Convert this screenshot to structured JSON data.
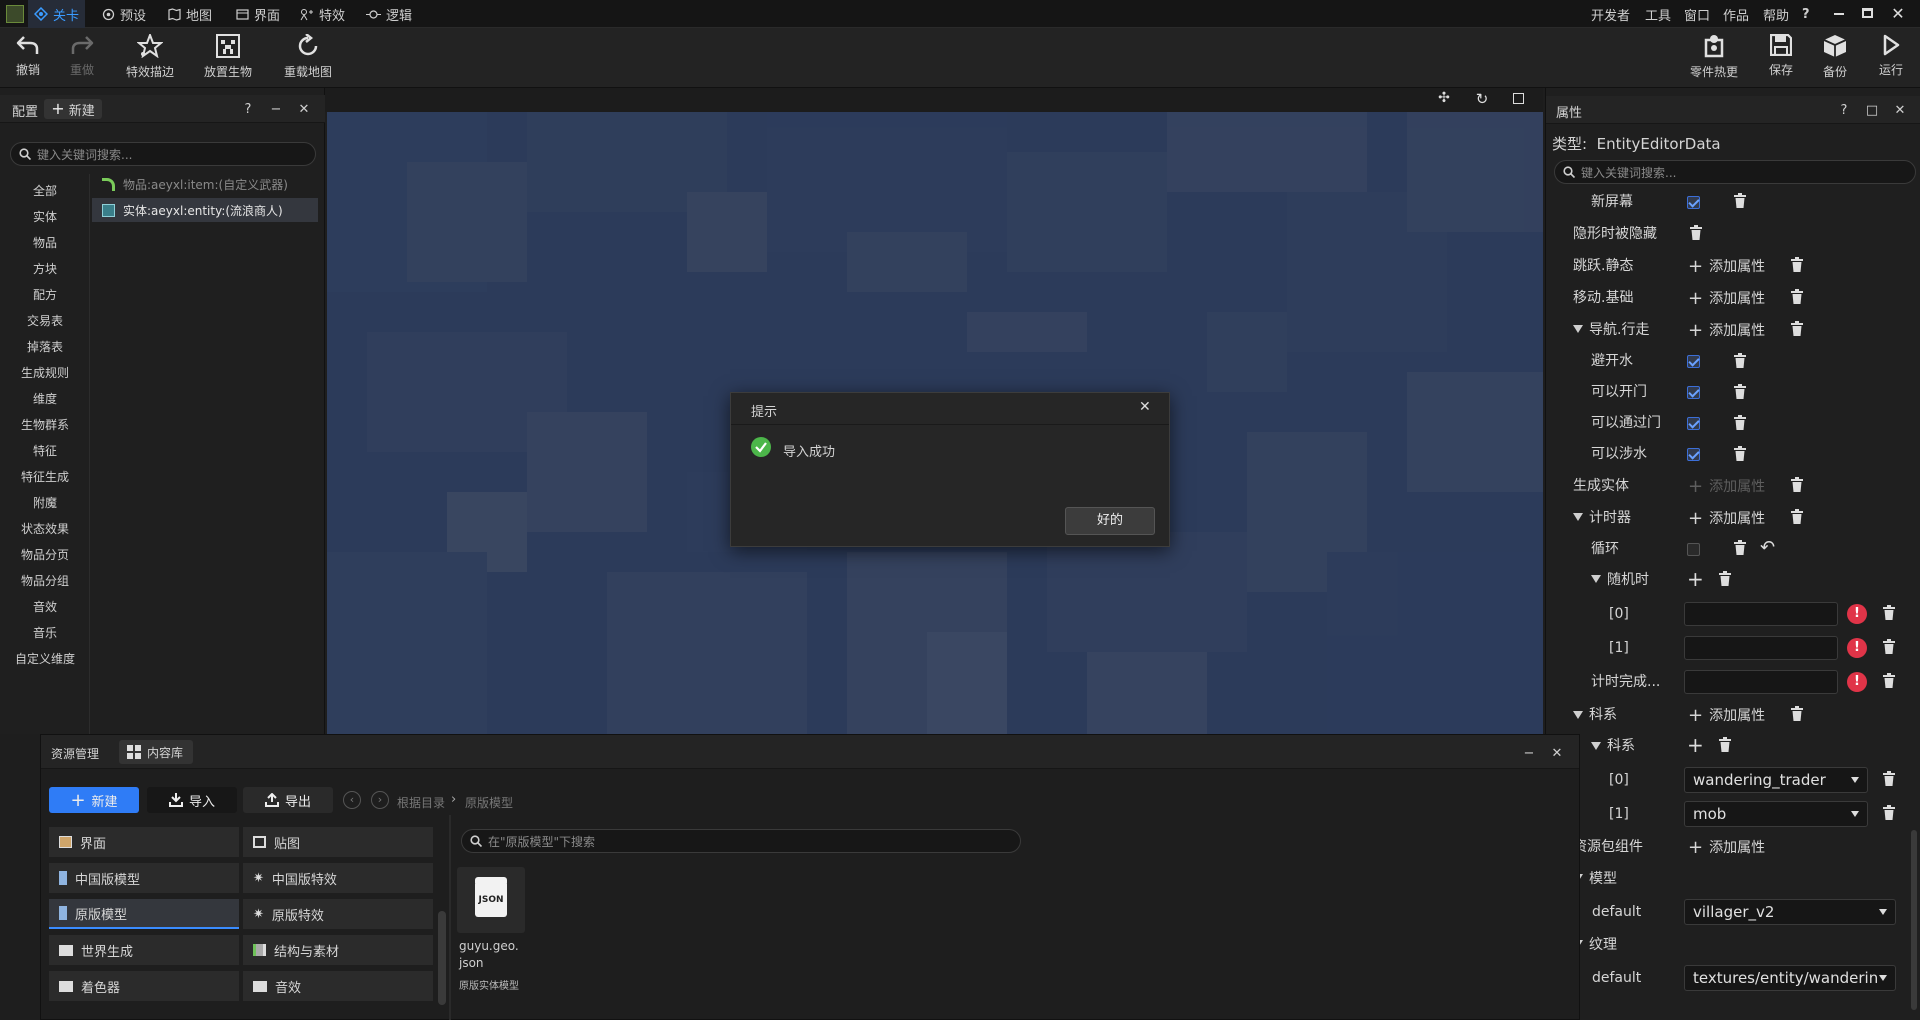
{
  "menubar": {
    "tabs": [
      {
        "label": "关卡",
        "icon": "level-icon"
      },
      {
        "label": "预设",
        "icon": "preset-icon"
      },
      {
        "label": "地图",
        "icon": "map-icon"
      },
      {
        "label": "界面",
        "icon": "interface-icon"
      },
      {
        "label": "特效",
        "icon": "effects-icon"
      },
      {
        "label": "逻辑",
        "icon": "logic-icon"
      }
    ],
    "right_menu": [
      "开发者",
      "工具",
      "窗口",
      "作品",
      "帮助",
      "?"
    ]
  },
  "toolbar": {
    "left": [
      {
        "label": "撤销",
        "icon": "undo-icon",
        "enabled": true
      },
      {
        "label": "重做",
        "icon": "redo-icon",
        "enabled": false
      },
      {
        "label": "特效描边",
        "icon": "effect-outline-icon",
        "enabled": true
      },
      {
        "label": "放置生物",
        "icon": "place-creature-icon",
        "enabled": true
      },
      {
        "label": "重载地图",
        "icon": "reload-map-icon",
        "enabled": true
      }
    ],
    "right": [
      {
        "label": "零件热更",
        "icon": "hot-update-icon"
      },
      {
        "label": "保存",
        "icon": "save-icon"
      },
      {
        "label": "备份",
        "icon": "backup-icon"
      },
      {
        "label": "运行",
        "icon": "run-icon"
      }
    ]
  },
  "config_panel": {
    "title": "配置",
    "new_label": "新建",
    "search_placeholder": "键入关键词搜索...",
    "categories": [
      "全部",
      "实体",
      "物品",
      "方块",
      "配方",
      "交易表",
      "掉落表",
      "生成规则",
      "维度",
      "生物群系",
      "特征",
      "特征生成",
      "附魔",
      "状态效果",
      "物品分页",
      "物品分组",
      "音效",
      "音乐",
      "自定义维度"
    ],
    "items": [
      {
        "label": "物品:aeyxl:item:(自定义武器)",
        "selected": false
      },
      {
        "label": "实体:aeyxl:entity:(流浪商人)",
        "selected": true
      }
    ]
  },
  "dialog": {
    "title": "提示",
    "message": "导入成功",
    "ok_label": "好的"
  },
  "properties_panel": {
    "title": "属性",
    "type_line": "类型:  EntityEditorData",
    "search_placeholder": "键入关键词搜索...",
    "add_label": "添加属性",
    "rows": {
      "new_screen": "新屏幕",
      "hidden_when_invisible": "隐形时被隐藏",
      "jump_static": "跳跃.静态",
      "move_basic": "移动.基础",
      "nav_walk": "导航.行走",
      "avoid_water": "避开水",
      "can_open_doors": "可以开门",
      "can_pass_doors": "可以通过门",
      "can_wade": "可以涉水",
      "spawn_entity": "生成实体",
      "timer": "计时器",
      "loop": "循环",
      "random_time": "随机时",
      "index0": "[0]",
      "index1": "[1]",
      "timer_done": "计时完成...",
      "family": "科系",
      "family_sub": "科系",
      "family_values": [
        "wandering_trader",
        "mob"
      ],
      "resource_pack_components": "资源包组件",
      "model": "模型",
      "model_default_key": "default",
      "model_default_value": "villager_v2",
      "texture": "纹理",
      "texture_default_key": "default",
      "texture_default_value": "textures/entity/wanderin"
    },
    "checkbox_states": {
      "new_screen": true,
      "avoid_water": true,
      "can_open_doors": true,
      "can_pass_doors": true,
      "can_wade": true,
      "loop": false
    }
  },
  "resource_panel": {
    "tabs": [
      "资源管理",
      "内容库"
    ],
    "new_label": "新建",
    "import_label": "导入",
    "export_label": "导出",
    "breadcrumb": [
      "根据目录",
      "原版模型"
    ],
    "search_placeholder": "在\"原版模型\"下搜索",
    "left_items": [
      {
        "label": "界面",
        "icon": "interface-icon"
      },
      {
        "label": "中国版模型",
        "icon": "model-icon"
      },
      {
        "label": "原版模型",
        "icon": "model-icon",
        "selected": true
      },
      {
        "label": "世界生成",
        "icon": "folder-icon"
      },
      {
        "label": "着色器",
        "icon": "folder-icon"
      }
    ],
    "right_items": [
      {
        "label": "贴图",
        "icon": "texture-icon"
      },
      {
        "label": "中国版特效",
        "icon": "effects-icon"
      },
      {
        "label": "原版特效",
        "icon": "effects-icon"
      },
      {
        "label": "结构与素材",
        "icon": "structure-icon"
      },
      {
        "label": "音效",
        "icon": "folder-icon"
      }
    ],
    "file": {
      "name_line1": "guyu.geo.",
      "name_line2": "json",
      "badge": "JSON",
      "tag": "原版实体模型"
    }
  }
}
